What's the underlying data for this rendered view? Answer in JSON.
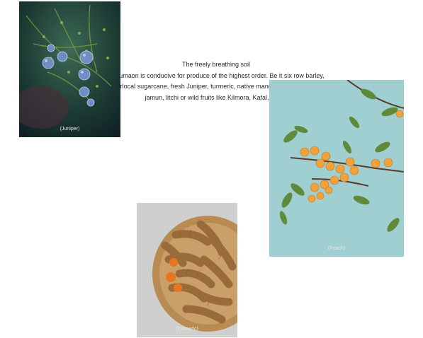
{
  "intro": {
    "heading": "The freely breathing soil",
    "body": "of Kumaon is conducive for produce of the highest order. Be it six row barley, hyperlocal sugarcane, fresh Juniper, turmeric, native mangoes, peach, guava, jamun, litchi or wild fruits like Kilmora, Kafal, Bedu."
  },
  "photos": [
    {
      "caption": "(Juniper)",
      "icon": "juniper-photo"
    },
    {
      "caption": "(Peach)",
      "icon": "peach-photo"
    },
    {
      "caption": "(Turmeric)",
      "icon": "turmeric-photo"
    }
  ]
}
